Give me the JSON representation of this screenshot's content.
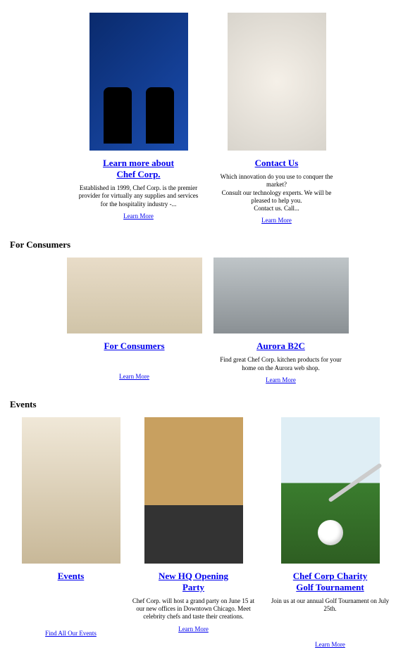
{
  "topCards": [
    {
      "titleLine1": "Learn more about",
      "titleLine2": "Chef Corp.",
      "desc": "Established in 1999, Chef Corp. is the premier provider for virtually any supplies and services for the hospitality industry -...",
      "link": "Learn More"
    },
    {
      "titleLine1": "Contact Us",
      "titleLine2": "",
      "desc": "Which innovation do you use to conquer the market?\nConsult our technology experts. We will be pleased to help you.\nContact us. Call...",
      "link": "Learn More"
    }
  ],
  "sections": {
    "consumers": {
      "heading": "For Consumers",
      "cards": [
        {
          "title": "For Consumers",
          "desc": "",
          "link": "Learn More"
        },
        {
          "title": "Aurora B2C",
          "desc": "Find great Chef Corp. kitchen products for your home on the Aurora web shop.",
          "link": "Learn More"
        }
      ]
    },
    "events": {
      "heading": "Events",
      "cards": [
        {
          "titleLine1": "Events",
          "titleLine2": "",
          "desc": "",
          "link": "Find All Our Events"
        },
        {
          "titleLine1": "New HQ Opening",
          "titleLine2": "Party",
          "desc": "Chef Corp. will host a grand party on June 15 at our new offices in Downtown Chicago. Meet celebrity chefs and taste their creations.",
          "link": "Learn More"
        },
        {
          "titleLine1": "Chef Corp Charity",
          "titleLine2": "Golf Tournament",
          "desc": "Join us at our annual Golf Tournament on July 25th.",
          "link": "Learn More"
        }
      ]
    }
  }
}
